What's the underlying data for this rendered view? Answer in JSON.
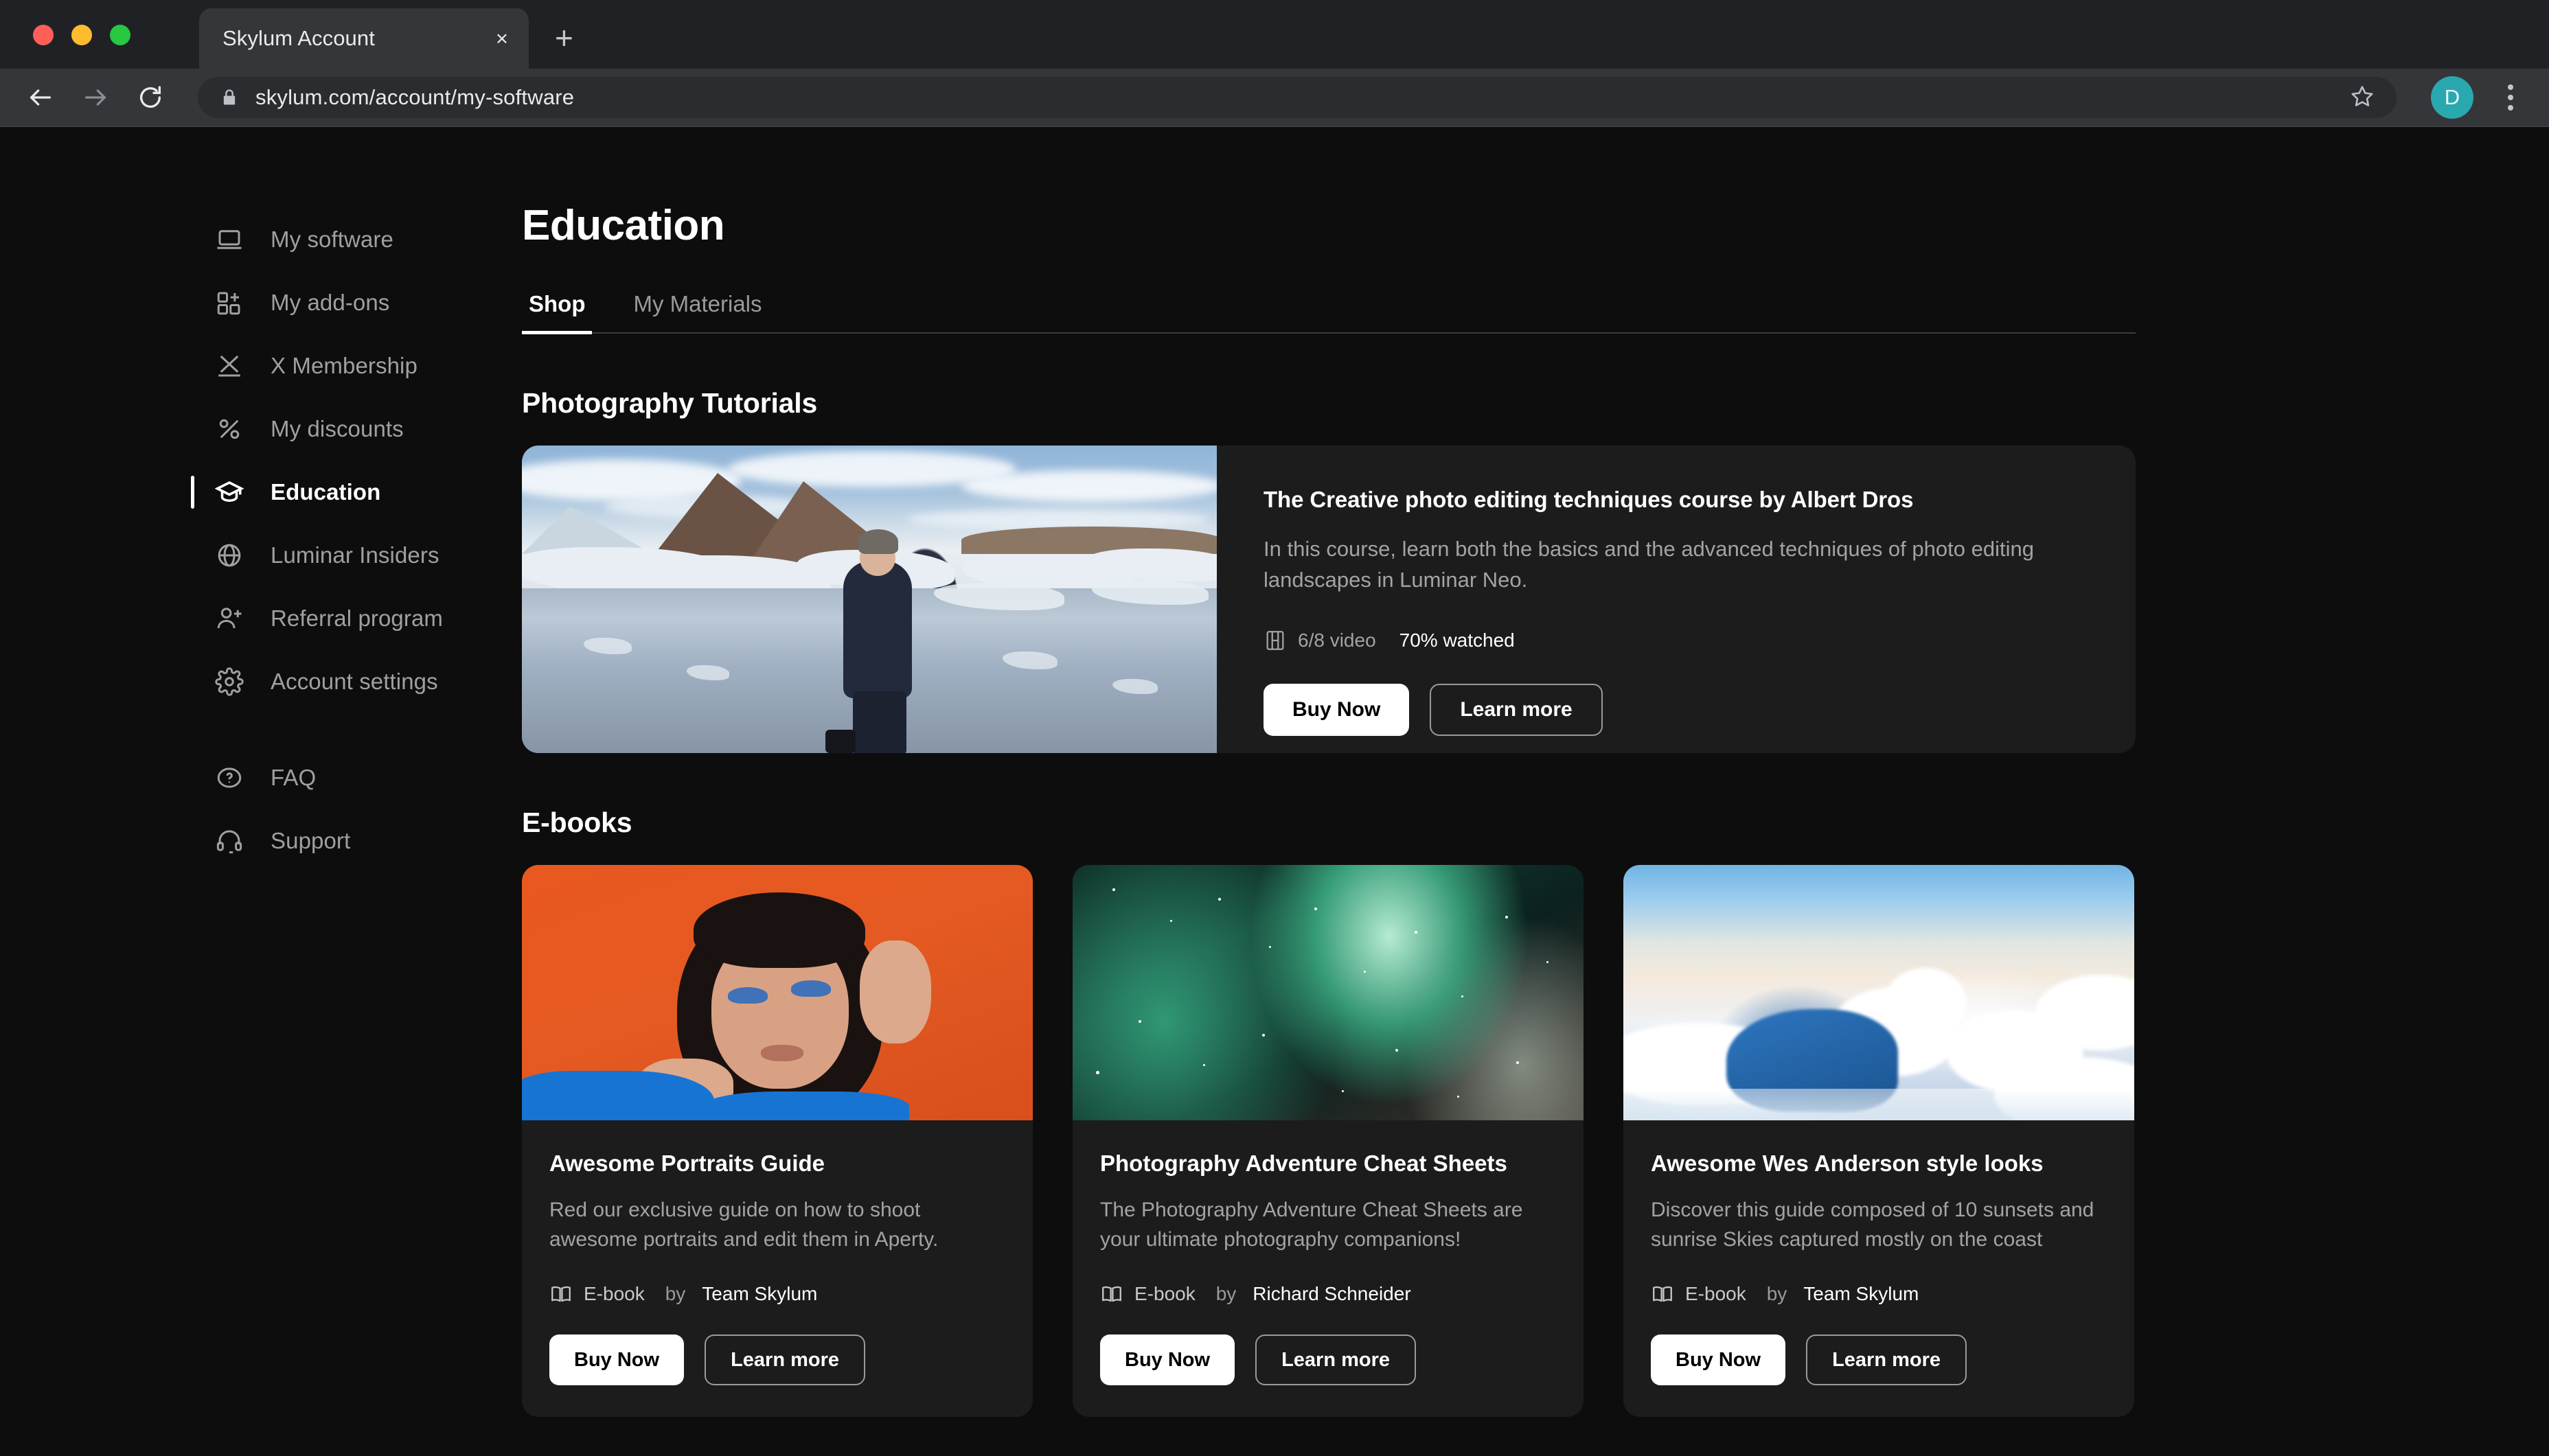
{
  "browser": {
    "tab_title": "Skylum Account",
    "close_label": "×",
    "newtab_label": "+",
    "url": "skylum.com/account/my-software",
    "avatar_initial": "D",
    "accent_avatar": "#2aa8b0"
  },
  "sidebar": {
    "items": [
      {
        "label": "My software",
        "icon": "laptop-icon",
        "active": false
      },
      {
        "label": "My add-ons",
        "icon": "grid-plus-icon",
        "active": false
      },
      {
        "label": "X Membership",
        "icon": "x-icon",
        "active": false
      },
      {
        "label": "My discounts",
        "icon": "percent-icon",
        "active": false
      },
      {
        "label": "Education",
        "icon": "graduation-cap-icon",
        "active": true
      },
      {
        "label": "Luminar Insiders",
        "icon": "globe-icon",
        "active": false
      },
      {
        "label": "Referral program",
        "icon": "user-plus-icon",
        "active": false
      },
      {
        "label": "Account settings",
        "icon": "gear-icon",
        "active": false
      }
    ],
    "footer_items": [
      {
        "label": "FAQ",
        "icon": "question-circle-icon"
      },
      {
        "label": "Support",
        "icon": "headset-icon"
      }
    ]
  },
  "main": {
    "page_title": "Education",
    "tabs": [
      {
        "label": "Shop",
        "selected": true
      },
      {
        "label": "My Materials",
        "selected": false
      }
    ],
    "sections": [
      {
        "title": "Photography Tutorials"
      },
      {
        "title": "E-books"
      }
    ],
    "course": {
      "title": "The Creative photo editing techniques course by Albert Dros",
      "description": "In this course, learn both the basics and the advanced techniques of photo editing landscapes in Luminar Neo.",
      "video_count": "6/8 video",
      "watched": "70% watched",
      "image_alt": "photographer standing in icy glacier lagoon",
      "buy_label": "Buy Now",
      "learn_label": "Learn more"
    },
    "ebooks": [
      {
        "title": "Awesome Portraits Guide",
        "description": "Red our exclusive guide on how to shoot awesome portraits and edit them in Aperty.",
        "type": "E-book",
        "by": "by",
        "author": "Team Skylum",
        "buy_label": "Buy Now",
        "learn_label": "Learn more",
        "image_alt": "portrait of woman on orange background"
      },
      {
        "title": "Photography Adventure Cheat Sheets",
        "description": "The Photography Adventure Cheat Sheets are your ultimate photography companions!",
        "type": "E-book",
        "by": "by",
        "author": "Richard Schneider",
        "buy_label": "Buy Now",
        "learn_label": "Learn more",
        "image_alt": "green aurora borealis over starry sky"
      },
      {
        "title": "Awesome Wes Anderson style looks",
        "description": "Discover this guide composed of 10 sunsets and sunrise Skies captured mostly on the coast",
        "type": "E-book",
        "by": "by",
        "author": "Team Skylum",
        "buy_label": "Buy Now",
        "learn_label": "Learn more",
        "image_alt": "clouds seen from above"
      }
    ]
  }
}
